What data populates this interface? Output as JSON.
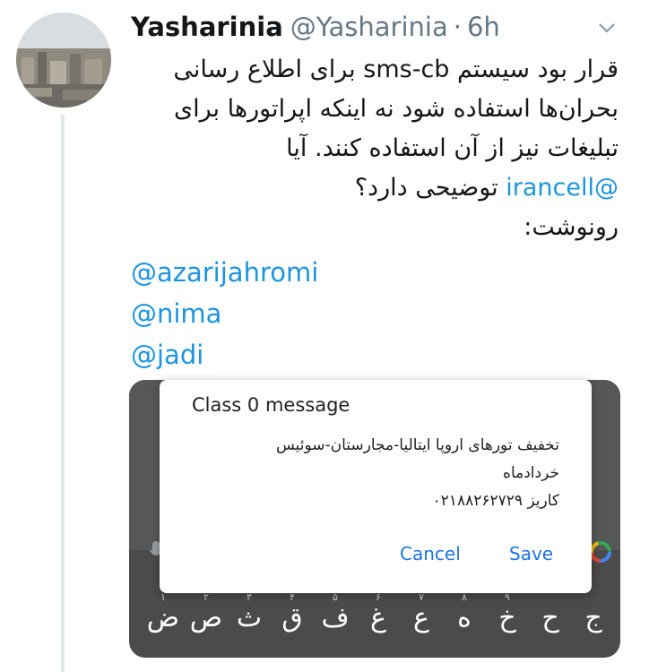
{
  "tweet": {
    "display_name": "Yasharinia",
    "handle": "@Yasharinia",
    "separator": "·",
    "time": "6h",
    "body": {
      "line1": "قرار بود سیستم sms-cb برای اطلاع رسانی",
      "line2": "بحران‌ها استفاده شود نه اینکه اپراتورها برای",
      "line3": "تبلیغات نیز از آن استفاده کنند. آیا",
      "line4_mention": "@irancell",
      "line4_text": " توضیحی دارد؟",
      "line5": "رونوشت:"
    },
    "mentions": [
      "@azarijahromi",
      "@nima",
      "@jadi"
    ],
    "icons": {
      "menu": "chevron-down-icon"
    }
  },
  "screenshot": {
    "dialog": {
      "title": "Class 0 message",
      "message_line1": "تخفیف تورهای اروپا ایتالیا-مجارستان-سوئیس",
      "message_line2": "خردادماه",
      "message_line3": "کاریز ۰۲۱۸۸۲۶۲۷۲۹",
      "cancel_label": "Cancel",
      "save_label": "Save"
    },
    "keyboard": {
      "keys": [
        "ج",
        "ح",
        "خ",
        "ه",
        "ع",
        "غ",
        "ف",
        "ق",
        "ث",
        "ص",
        "ض"
      ],
      "hints": [
        "",
        "",
        "۹",
        "۸",
        "۷",
        "۶",
        "۵",
        "۴",
        "۳",
        "۲",
        "۱"
      ]
    }
  },
  "colors": {
    "link": "#1b95e0",
    "dialog_button": "#1a73e8",
    "muted": "#657786"
  }
}
